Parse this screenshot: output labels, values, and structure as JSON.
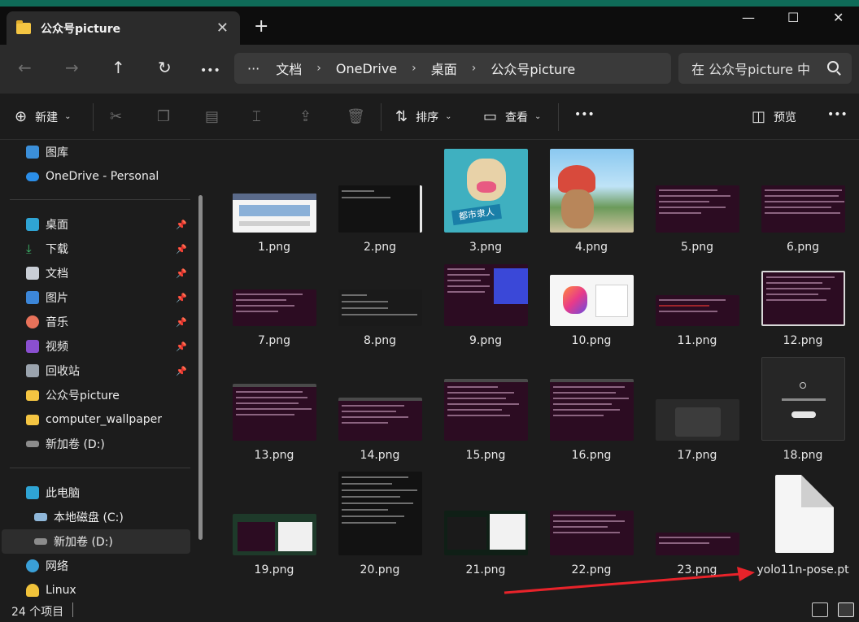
{
  "window": {
    "tab_title": "公众号picture",
    "close_tab": "✕",
    "new_tab": "+",
    "minimize": "—",
    "maximize": "☐",
    "close": "✕"
  },
  "nav": {
    "back": "←",
    "forward": "→",
    "up": "↑",
    "refresh": "↻",
    "more": "•••"
  },
  "breadcrumb": {
    "overflow": "···",
    "items": [
      "文档",
      "OneDrive",
      "桌面",
      "公众号picture"
    ],
    "separator": "›"
  },
  "search": {
    "placeholder": "在 公众号picture 中"
  },
  "toolbar": {
    "new_label": "新建",
    "sort_label": "排序",
    "view_label": "查看",
    "more": "•••",
    "preview_label": "预览"
  },
  "sidebar": {
    "items": [
      {
        "label": "图库"
      },
      {
        "label": "OneDrive - Personal"
      },
      {
        "label": "桌面"
      },
      {
        "label": "下载"
      },
      {
        "label": "文档"
      },
      {
        "label": "图片"
      },
      {
        "label": "音乐"
      },
      {
        "label": "视频"
      },
      {
        "label": "回收站"
      },
      {
        "label": "公众号picture"
      },
      {
        "label": "computer_wallpaper"
      },
      {
        "label": "新加卷 (D:)"
      },
      {
        "label": "此电脑"
      },
      {
        "label": "本地磁盘 (C:)"
      },
      {
        "label": "新加卷 (D:)"
      },
      {
        "label": "网络"
      },
      {
        "label": "Linux"
      }
    ]
  },
  "files": [
    "1.png",
    "2.png",
    "3.png",
    "4.png",
    "5.png",
    "6.png",
    "7.png",
    "8.png",
    "9.png",
    "10.png",
    "11.png",
    "12.png",
    "13.png",
    "14.png",
    "15.png",
    "16.png",
    "17.png",
    "18.png",
    "19.png",
    "20.png",
    "21.png",
    "22.png",
    "23.png",
    "yolo11n-pose.pt"
  ],
  "thumb_text": {
    "sign": "都市隶人"
  },
  "status": {
    "count": "24 个项目"
  },
  "colors": {
    "accent": "#0f6b58",
    "terminal": "#2c0c22",
    "folder": "#f4c542",
    "arrow": "#e8232a"
  }
}
